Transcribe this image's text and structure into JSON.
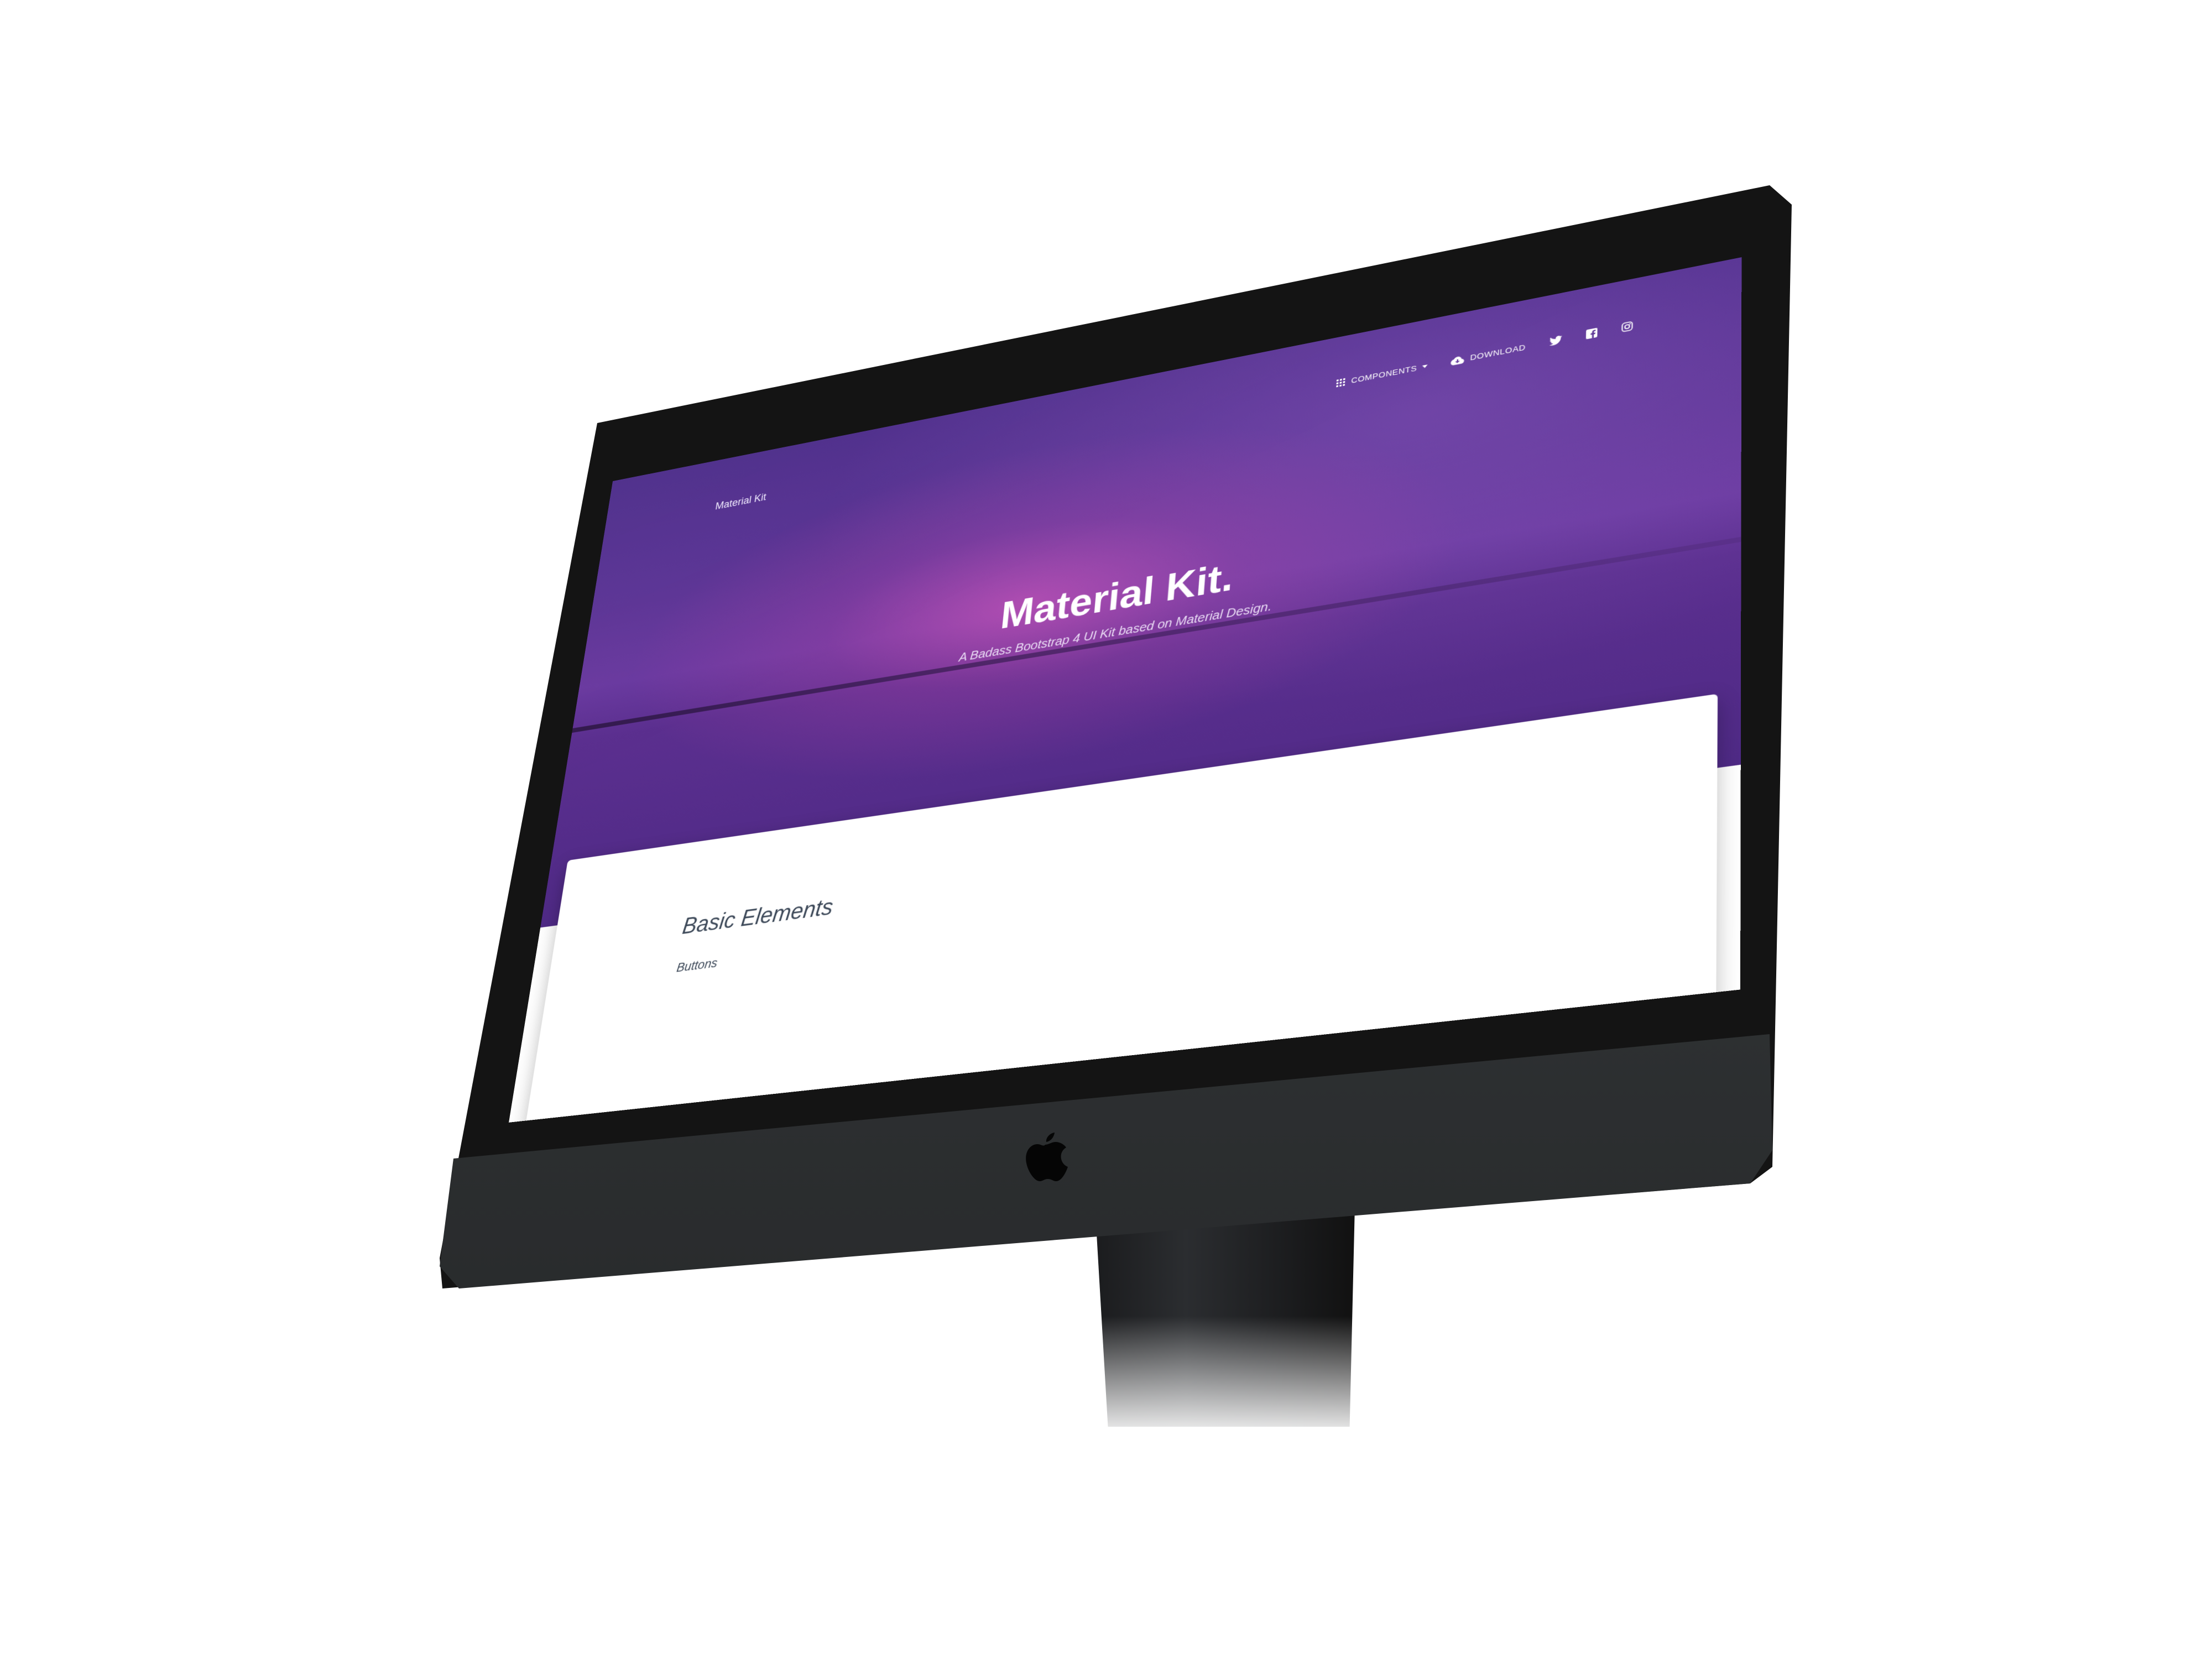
{
  "device": {
    "logo_icon": "apple-logo-icon"
  },
  "site": {
    "brand": "Material Kit",
    "nav": {
      "components_label": "COMPONENTS",
      "components_icon": "apps-grid-icon",
      "download_label": "DOWNLOAD",
      "download_icon": "cloud-download-icon",
      "social_icons": [
        "twitter-icon",
        "facebook-icon",
        "instagram-icon"
      ]
    },
    "hero": {
      "title": "Material Kit.",
      "subtitle": "A Badass Bootstrap 4 UI Kit based on Material Design."
    },
    "content": {
      "section_title": "Basic Elements",
      "section_subtitle": "Buttons"
    }
  },
  "colors": {
    "hero_purple": "#5d3596",
    "accent_pink": "#e05ab8",
    "text_dark": "#3c4858"
  }
}
